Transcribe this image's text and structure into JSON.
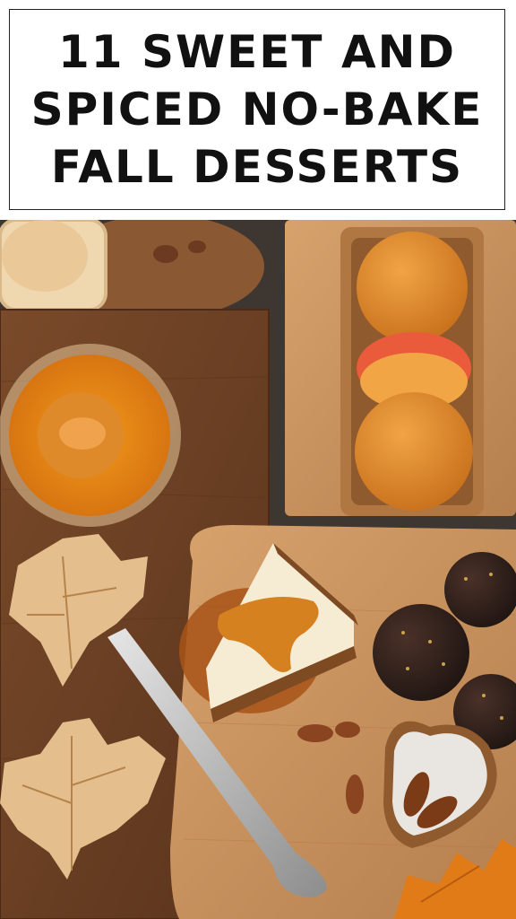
{
  "pin": {
    "title": "11 SWEET AND\nSPICED NO-BAKE\nFALL DESSERTS"
  },
  "colors": {
    "table": "#3d3631",
    "board_dark": "#6e4225",
    "board_light": "#c9915e",
    "pumpkin": "#e8891b",
    "caramel": "#c9781f",
    "chocolate": "#2e1f1a",
    "cream": "#f6ecd3"
  }
}
